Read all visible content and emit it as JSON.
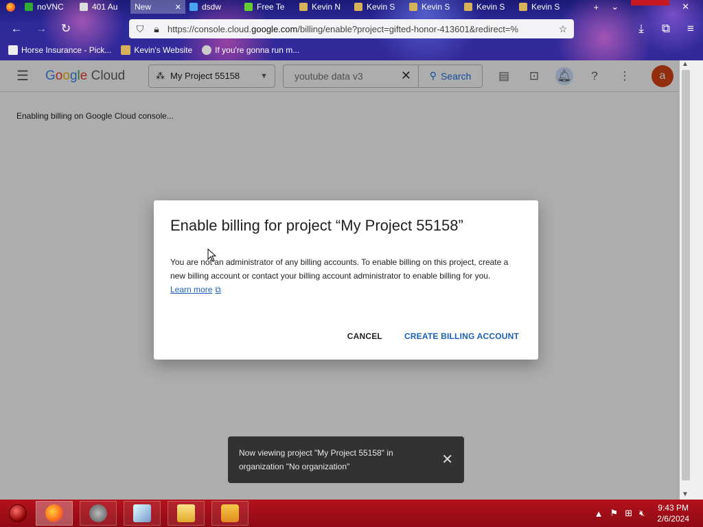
{
  "browser": {
    "tabs": [
      {
        "label": "",
        "icon": "firefox-icon"
      },
      {
        "label": "noVNC",
        "icon": "vnc-icon"
      },
      {
        "label": "401 Au",
        "icon": "tab-page-icon"
      },
      {
        "label": "New",
        "icon": "new-tab-icon",
        "active": true
      },
      {
        "label": "dsdw",
        "icon": "tab-page-icon"
      },
      {
        "label": "Free Te",
        "icon": "tab-page-icon"
      },
      {
        "label": "Kevin N",
        "icon": "tab-page-icon"
      },
      {
        "label": "Kevin S",
        "icon": "tab-page-icon"
      },
      {
        "label": "Kevin S",
        "icon": "tab-page-icon"
      },
      {
        "label": "Kevin S",
        "icon": "tab-page-icon"
      },
      {
        "label": "Kevin S",
        "icon": "tab-page-icon"
      }
    ],
    "url_prefix": "https://console.cloud.",
    "url_domain": "google.com",
    "url_suffix": "/billing/enable?project=gifted-honor-413601&redirect=%",
    "bookmarks": [
      {
        "label": "Horse Insurance - Pick..."
      },
      {
        "label": "Kevin's Website"
      },
      {
        "label": "If you're gonna run m..."
      }
    ]
  },
  "console": {
    "logo": [
      "G",
      "o",
      "o",
      "g",
      "l",
      "e"
    ],
    "logo_suffix": "Cloud",
    "project_name": "My Project 55158",
    "search_value": "youtube data v3",
    "search_label": "Search",
    "avatar_letter": "a",
    "enabling_text": "Enabling billing on Google Cloud console..."
  },
  "dialog": {
    "title": "Enable billing for project “My Project 55158”",
    "body": "You are not an administrator of any billing accounts. To enable billing on this project, create a new billing account or contact your billing account administrator to enable billing for you.",
    "learn_more": "Learn more",
    "cancel_label": "CANCEL",
    "create_label": "CREATE BILLING ACCOUNT"
  },
  "snackbar": {
    "text": "Now viewing project \"My Project 55158\" in organization \"No organization\""
  },
  "taskbar": {
    "time": "9:43 PM",
    "date": "2/6/2024"
  }
}
